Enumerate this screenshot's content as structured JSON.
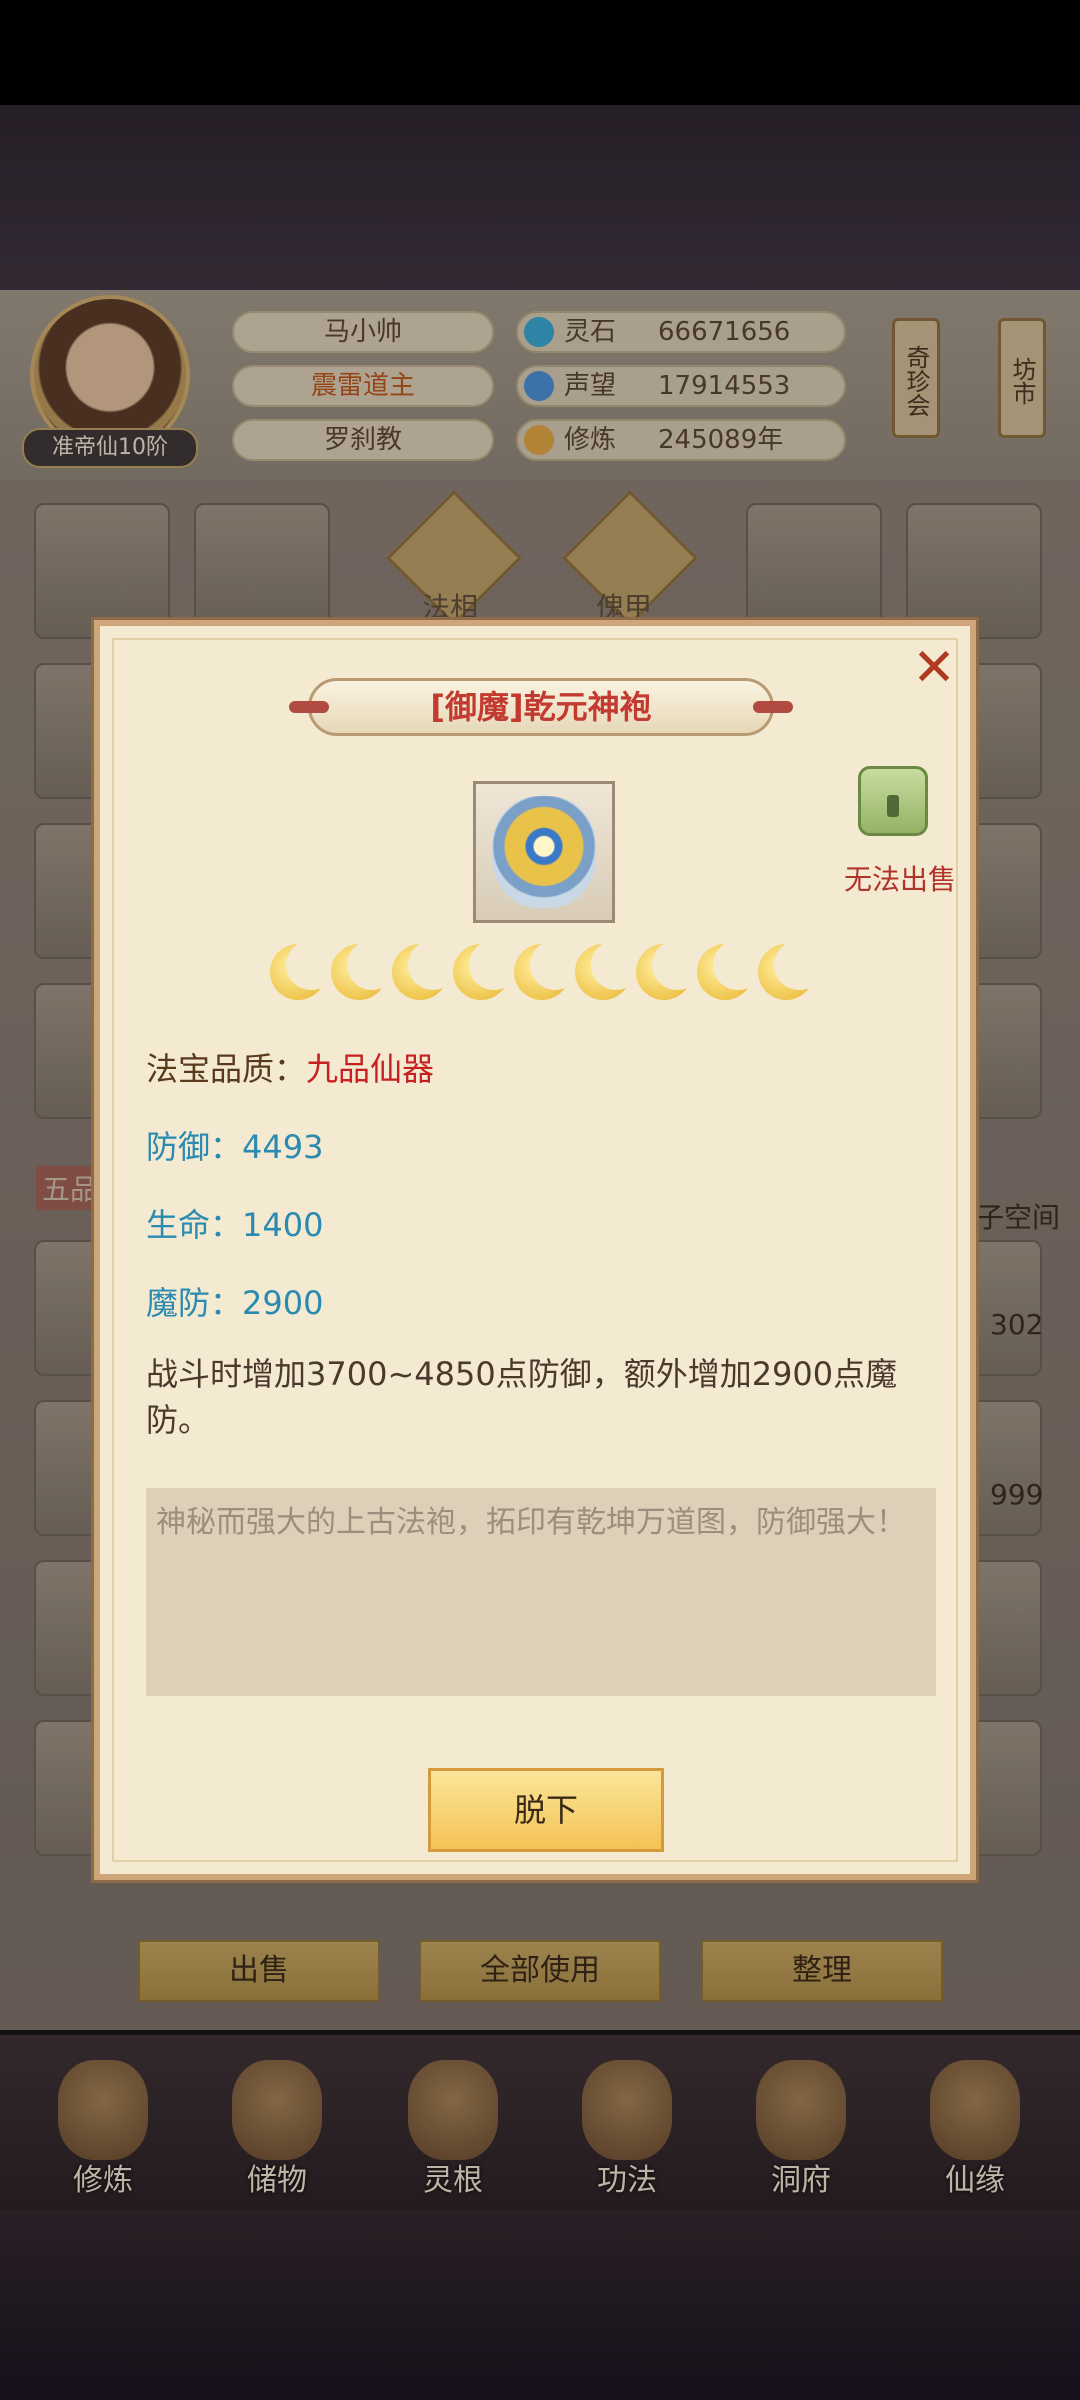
{
  "header": {
    "rank": "准帝仙10阶",
    "player_name": "马小帅",
    "title": "震雷道主",
    "sect": "罗刹教",
    "stats": [
      {
        "label": "灵石",
        "value": "66671656",
        "icon": "spirit-stone-icon"
      },
      {
        "label": "声望",
        "value": "17914553",
        "icon": "reputation-icon"
      },
      {
        "label": "修炼",
        "value": "245089年",
        "icon": "cultivation-icon"
      }
    ],
    "side_buttons": [
      "奇珍会",
      "坊市"
    ]
  },
  "background": {
    "slot_labels": [
      "法相",
      "傀甲"
    ],
    "partial_texts": [
      "五品",
      "子空间",
      "302",
      "999"
    ]
  },
  "actions": [
    "出售",
    "全部使用",
    "整理"
  ],
  "nav": [
    "修炼",
    "储物",
    "灵根",
    "功法",
    "洞府",
    "仙缘"
  ],
  "modal": {
    "title": "[御魔]乾元神袍",
    "no_sell": "无法出售",
    "stars": 9,
    "quality_label": "法宝品质：",
    "quality_value": "九品仙器",
    "attrs": [
      {
        "text": "防御：4493"
      },
      {
        "text": "生命：1400"
      },
      {
        "text": "魔防：2900"
      }
    ],
    "effect": "战斗时增加3700~4850点防御，额外增加2900点魔防。",
    "description": "神秘而强大的上古法袍，拓印有乾坤万道图，防御强大！",
    "button": "脱下"
  }
}
